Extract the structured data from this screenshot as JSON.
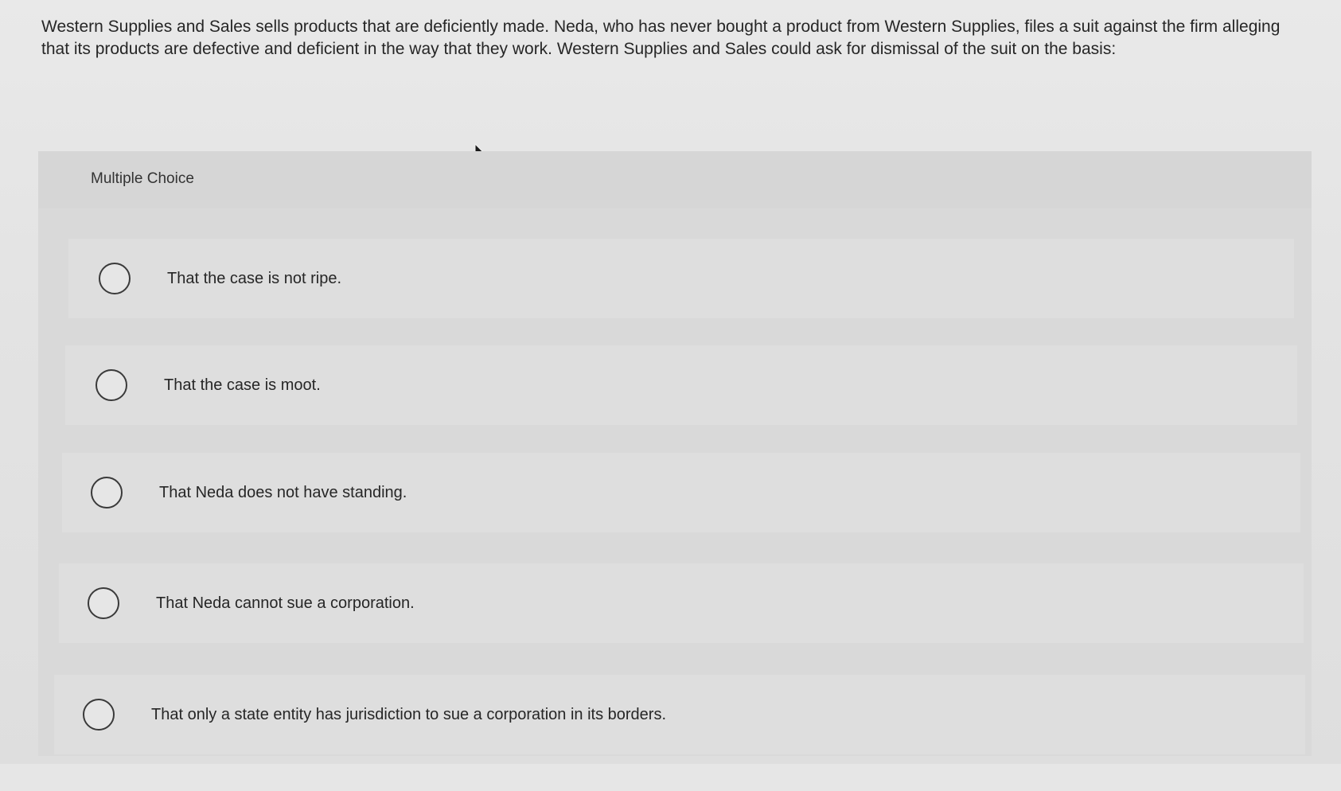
{
  "question": {
    "text": "Western Supplies and Sales sells products that are deficiently made. Neda, who has never bought a product from Western Supplies, files a suit against the firm alleging that its products are defective and deficient in the way that they work. Western Supplies and Sales could ask for dismissal of the suit on the basis:"
  },
  "multiple_choice": {
    "title": "Multiple Choice",
    "options": [
      {
        "label": "That the case is not ripe.",
        "selected": false
      },
      {
        "label": "That the case is moot.",
        "selected": false
      },
      {
        "label": "That Neda does not have standing.",
        "selected": false
      },
      {
        "label": "That Neda cannot sue a corporation.",
        "selected": false
      },
      {
        "label": "That only a state entity has jurisdiction to sue a corporation in its borders.",
        "selected": false
      }
    ]
  },
  "icons": {
    "pointer": "mouse-pointer-icon",
    "radio": "radio-unselected-icon"
  },
  "colors": {
    "background": "#e4e4e4",
    "panel": "#d9d9d9",
    "option_row": "#dedede",
    "text": "#262626"
  }
}
